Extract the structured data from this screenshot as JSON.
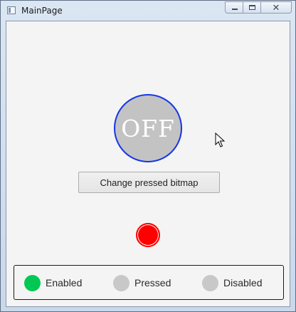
{
  "window": {
    "title": "MainPage"
  },
  "toggle": {
    "label": "OFF",
    "color": "#c3c3c3",
    "border_color": "#1536e6"
  },
  "change_button": {
    "label": "Change pressed bitmap"
  },
  "indicator": {
    "color": "#ff0000"
  },
  "status": {
    "items": [
      {
        "label": "Enabled",
        "color": "#00c853",
        "active": true
      },
      {
        "label": "Pressed",
        "color": "#c8c8c8",
        "active": false
      },
      {
        "label": "Disabled",
        "color": "#c8c8c8",
        "active": false
      }
    ]
  }
}
